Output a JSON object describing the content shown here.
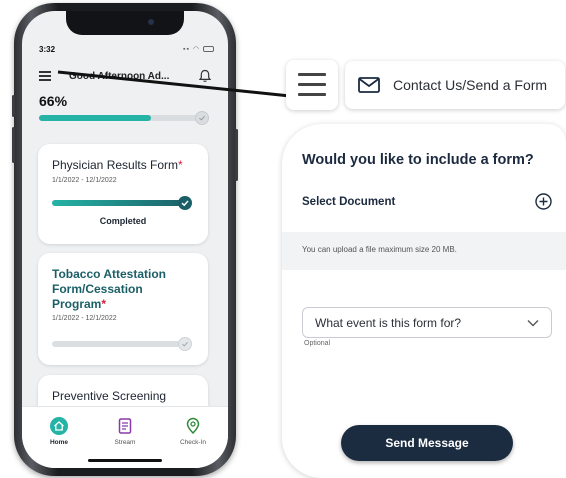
{
  "colors": {
    "teal": "#25b3a6",
    "dark_teal": "#1b5f66",
    "navy": "#1b2b40",
    "required_star": "#d0213a",
    "stream_purple": "#8a3aa8",
    "checkin_green": "#2f8a3a"
  },
  "phone": {
    "status": {
      "time": "3:32"
    },
    "header": {
      "greeting": "Good Afternoon Ad...",
      "menu_icon": "menu-icon",
      "bell_icon": "bell-icon"
    },
    "progress": {
      "label": "66%",
      "value_percent": 66
    },
    "cards": [
      {
        "title": "Physician Results Form",
        "required_mark": "*",
        "dates": "1/1/2022 - 12/1/2022",
        "status": "Completed",
        "progress_percent": 100
      },
      {
        "title": "Tobacco Attestation Form/Cessation Program",
        "required_mark": "*",
        "dates": "1/1/2022 - 12/1/2022",
        "progress_percent": 0
      },
      {
        "title": "Preventive Screening"
      }
    ],
    "tabs": [
      {
        "label": "Home",
        "icon": "home-icon",
        "active": true
      },
      {
        "label": "Stream",
        "icon": "stream-icon",
        "active": false
      },
      {
        "label": "Check-In",
        "icon": "map-pin-icon",
        "active": false
      }
    ]
  },
  "callout": {
    "menu_icon": "menu-icon",
    "contact": {
      "label": "Contact Us/Send a Form",
      "icon": "mail-icon"
    }
  },
  "form": {
    "question": "Would you like to include a form?",
    "select_document": "Select Document",
    "upload_note": "You can upload a file maximum size 20 MB.",
    "event_select": {
      "placeholder": "What event is this form for?"
    },
    "optional_note": "Optional",
    "send_button": "Send Message"
  }
}
